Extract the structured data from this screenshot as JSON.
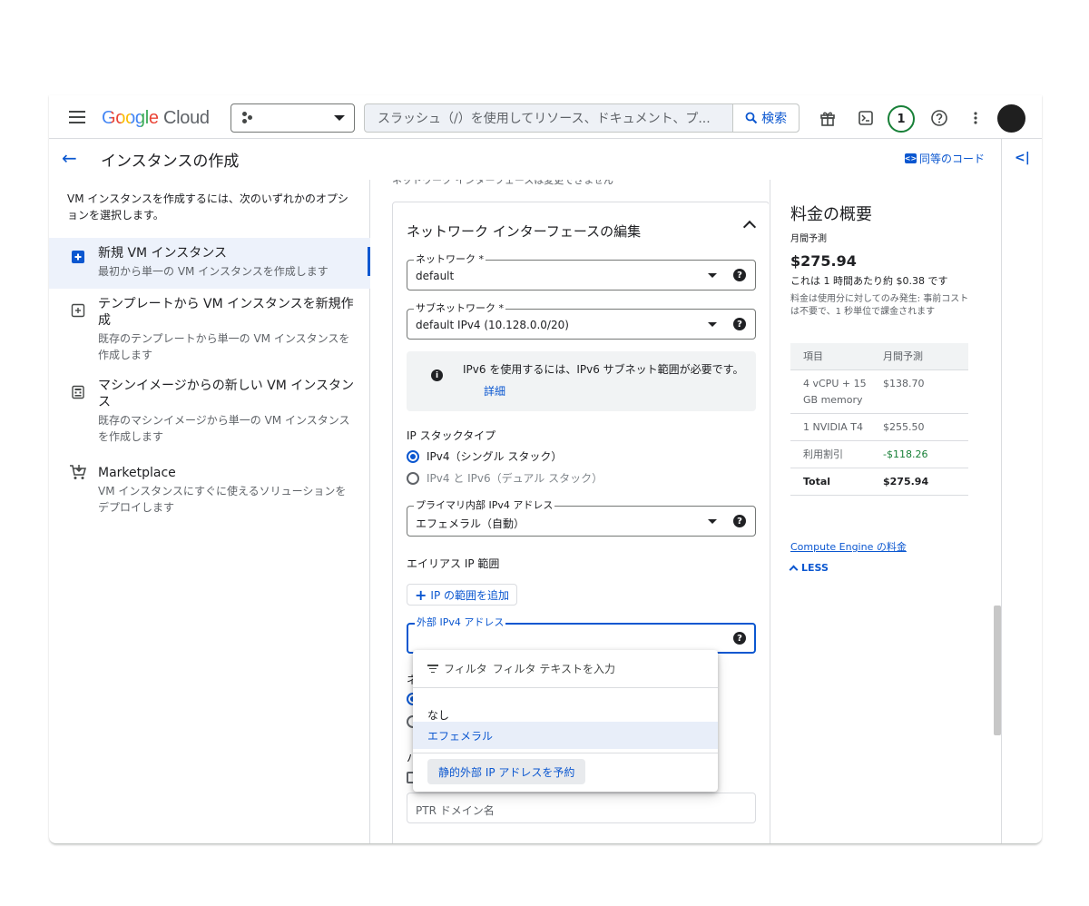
{
  "topbar": {
    "logo": {
      "google": "Google",
      "cloud": "Cloud"
    },
    "search_placeholder": "スラッシュ（/）を使用してリソース、ドキュメント、プ...",
    "search_button": "検索",
    "notifications_count": "1",
    "icons": [
      "menu-icon",
      "project-icon",
      "search-icon",
      "gift-icon",
      "terminal-icon",
      "help-icon",
      "more-vert-icon",
      "avatar"
    ]
  },
  "header": {
    "title": "インスタンスの作成",
    "equivalent_code": "同等のコード"
  },
  "leftnav": {
    "intro": "VM インスタンスを作成するには、次のいずれかのオプションを選択します。",
    "options": [
      {
        "title": "新規 VM インスタンス",
        "desc": "最初から単一の VM インスタンスを作成します"
      },
      {
        "title": "テンプレートから VM インスタンスを新規作成",
        "desc": "既存のテンプレートから単一の VM インスタンスを作成します"
      },
      {
        "title": "マシンイメージからの新しい VM インスタンス",
        "desc": "既存のマシンイメージから単一の VM インスタンスを作成します"
      },
      {
        "title": "Marketplace",
        "desc": "VM インスタンスにすぐに使えるソリューションをデプロイします"
      }
    ]
  },
  "center": {
    "cut_text": "ネットワーク インターフェースは変更できません",
    "card_title": "ネットワーク インターフェースの編集",
    "network": {
      "label": "ネットワーク *",
      "value": "default"
    },
    "subnetwork": {
      "label": "サブネットワーク *",
      "value": "default IPv4 (10.128.0.0/20)"
    },
    "info": {
      "text": "IPv6 を使用するには、IPv6 サブネット範囲が必要です。",
      "link": "詳細"
    },
    "ip_stack_title": "IP スタックタイプ",
    "ip_stack_options": [
      "IPv4（シングル スタック）",
      "IPv4 と IPv6（デュアル スタック）"
    ],
    "internal_ip": {
      "label": "プライマリ内部 IPv4 アドレス",
      "value": "エフェメラル（自動）"
    },
    "alias_title": "エイリアス IP 範囲",
    "add_range": "IP の範囲を追加",
    "external_ip": {
      "label": "外部 IPv4 アドレス"
    },
    "partial": [
      "ネ",
      "ハ"
    ],
    "ptr_placeholder": "PTR ドメイン名"
  },
  "dropdown": {
    "filter_label": "フィルタ",
    "filter_placeholder": "フィルタ テキストを入力",
    "items": [
      "なし",
      "エフェメラル"
    ],
    "selected": "エフェメラル",
    "reserve": "静的外部 IP アドレスを予約"
  },
  "pricing": {
    "title": "料金の概要",
    "subtitle": "月間予測",
    "amount": "$275.94",
    "hourly": "これは 1 時間あたり約 $0.38 です",
    "note": "料金は使用分に対してのみ発生: 事前コストは不要で、1 秒単位で課金されます",
    "table_head": {
      "item": "項目",
      "estimate": "月間予測"
    },
    "rows": [
      {
        "item": "4 vCPU + 15 GB memory",
        "estimate": "$138.70"
      },
      {
        "item": "1 NVIDIA T4",
        "estimate": "$255.50"
      },
      {
        "item": "利用割引",
        "estimate": "-$118.26"
      }
    ],
    "total": {
      "item": "Total",
      "estimate": "$275.94"
    },
    "link": "Compute Engine の料金",
    "less": "LESS"
  },
  "colors": {
    "accent": "#0b57d0",
    "discount": "#188038",
    "badge": "#188038"
  }
}
